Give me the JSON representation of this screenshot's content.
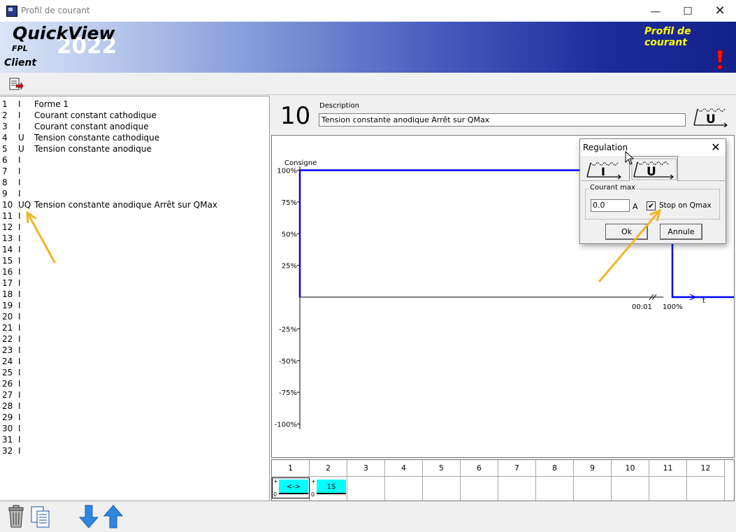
{
  "window": {
    "title": "Profil de courant",
    "min_symbol": "—",
    "max_symbol": "☐",
    "close_symbol": "✕"
  },
  "banner": {
    "brand": "QuickView",
    "year": "2022",
    "fpl": "FPL",
    "client": "Client",
    "title": "Profil de courant",
    "title_color": "#ffff00"
  },
  "list": {
    "items": [
      {
        "n": "1",
        "t": "I",
        "d": "Forme 1"
      },
      {
        "n": "2",
        "t": "I",
        "d": "Courant constant cathodique"
      },
      {
        "n": "3",
        "t": "I",
        "d": "Courant constant anodique"
      },
      {
        "n": "4",
        "t": "U",
        "d": "Tension constante cathodique"
      },
      {
        "n": "5",
        "t": "U",
        "d": "Tension constante anodique"
      },
      {
        "n": "6",
        "t": "I",
        "d": ""
      },
      {
        "n": "7",
        "t": "I",
        "d": ""
      },
      {
        "n": "8",
        "t": "I",
        "d": ""
      },
      {
        "n": "9",
        "t": "I",
        "d": ""
      },
      {
        "n": "10",
        "t": "UQ",
        "d": "Tension constante anodique Arrêt sur QMax"
      },
      {
        "n": "11",
        "t": "I",
        "d": ""
      },
      {
        "n": "12",
        "t": "I",
        "d": ""
      },
      {
        "n": "13",
        "t": "I",
        "d": ""
      },
      {
        "n": "14",
        "t": "I",
        "d": ""
      },
      {
        "n": "15",
        "t": "I",
        "d": ""
      },
      {
        "n": "16",
        "t": "I",
        "d": ""
      },
      {
        "n": "17",
        "t": "I",
        "d": ""
      },
      {
        "n": "18",
        "t": "I",
        "d": ""
      },
      {
        "n": "19",
        "t": "I",
        "d": ""
      },
      {
        "n": "20",
        "t": "I",
        "d": ""
      },
      {
        "n": "21",
        "t": "I",
        "d": ""
      },
      {
        "n": "22",
        "t": "I",
        "d": ""
      },
      {
        "n": "23",
        "t": "I",
        "d": ""
      },
      {
        "n": "24",
        "t": "I",
        "d": ""
      },
      {
        "n": "25",
        "t": "I",
        "d": ""
      },
      {
        "n": "26",
        "t": "I",
        "d": ""
      },
      {
        "n": "27",
        "t": "I",
        "d": ""
      },
      {
        "n": "28",
        "t": "I",
        "d": ""
      },
      {
        "n": "29",
        "t": "I",
        "d": ""
      },
      {
        "n": "30",
        "t": "I",
        "d": ""
      },
      {
        "n": "31",
        "t": "I",
        "d": ""
      },
      {
        "n": "32",
        "t": "I",
        "d": ""
      }
    ]
  },
  "profile": {
    "number": "10",
    "description_label": "Description",
    "description_value": "Tension constante anodique Arrêt sur QMax",
    "mode_icon": "voltage-mode-icon"
  },
  "chart": {
    "y_title": "Consigne",
    "y_ticks": [
      {
        "label": "100%",
        "value": 100
      },
      {
        "label": "75%",
        "value": 75
      },
      {
        "label": "50%",
        "value": 50
      },
      {
        "label": "25%",
        "value": 25
      },
      {
        "label": "-25%",
        "value": -25
      },
      {
        "label": "-50%",
        "value": -50
      },
      {
        "label": "-75%",
        "value": -75
      },
      {
        "label": "-100%",
        "value": -100
      }
    ],
    "x_time_label": "00:01",
    "x_end_label": "100%",
    "x_axis_label": "t",
    "series_color": "#0000ff",
    "setpoint_percent": 100
  },
  "regulation_dialog": {
    "title": "Regulation",
    "close_symbol": "✕",
    "tab_current_letter": "I",
    "tab_voltage_letter": "U",
    "group_label": "Courant max",
    "qmax_value": "0.0",
    "unit": "A",
    "checkbox_mark": "✔",
    "checkbox_label": "Stop on Qmax",
    "ok_label": "Ok",
    "cancel_label": "Annule"
  },
  "grid": {
    "columns": [
      "1",
      "2",
      "3",
      "4",
      "5",
      "6",
      "7",
      "8",
      "9",
      "10",
      "11",
      "12"
    ],
    "steps": [
      {
        "column": "1",
        "plus": "+",
        "zero": "0",
        "label": "<->",
        "color": "#00ffff"
      },
      {
        "column": "2",
        "plus": "+",
        "zero": "0",
        "label": "1S",
        "color": "#00ffff"
      }
    ]
  },
  "annotations": {
    "arrow_color": "#f0b429"
  }
}
